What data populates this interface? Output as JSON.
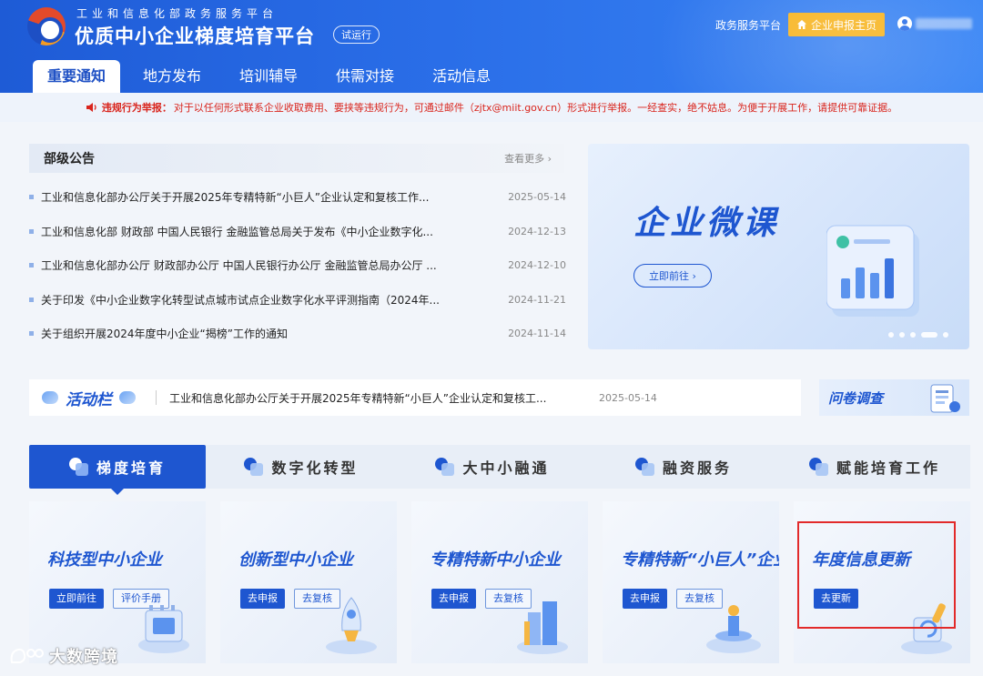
{
  "header": {
    "org_name": "工业和信息化部政务服务平台",
    "site_title": "优质中小企业梯度培育平台",
    "beta_badge": "试运行",
    "gov_link": "政务服务平台",
    "home_button": "企业申报主页"
  },
  "nav": {
    "items": [
      {
        "label": "重要通知"
      },
      {
        "label": "地方发布"
      },
      {
        "label": "培训辅导"
      },
      {
        "label": "供需对接"
      },
      {
        "label": "活动信息"
      }
    ]
  },
  "notice": {
    "label": "违规行为举报：",
    "text": "对于以任何形式联系企业收取费用、要挟等违规行为，可通过邮件（zjtx@miit.gov.cn）形式进行举报。一经查实，绝不姑息。为便于开展工作，请提供可靠证据。"
  },
  "announcements": {
    "title": "部级公告",
    "more": "查看更多 ›",
    "items": [
      {
        "text": "工业和信息化部办公厅关于开展2025年专精特新“小巨人”企业认定和复核工作...",
        "date": "2025-05-14"
      },
      {
        "text": "工业和信息化部 财政部 中国人民银行 金融监管总局关于发布《中小企业数字化...",
        "date": "2024-12-13"
      },
      {
        "text": "工业和信息化部办公厅 财政部办公厅 中国人民银行办公厅 金融监管总局办公厅 ...",
        "date": "2024-12-10"
      },
      {
        "text": "关于印发《中小企业数字化转型试点城市试点企业数字化水平评测指南（2024年...",
        "date": "2024-11-21"
      },
      {
        "text": "关于组织开展2024年度中小企业“揭榜”工作的通知",
        "date": "2024-11-14"
      }
    ]
  },
  "banner": {
    "title": "企业微课",
    "button": "立即前往 ›"
  },
  "activity": {
    "label": "活动栏",
    "text": "工业和信息化部办公厅关于开展2025年专精特新“小巨人”企业认定和复核工...",
    "date": "2025-05-14",
    "survey": "问卷调查"
  },
  "categories": [
    {
      "label": "梯度培育",
      "icon": "ladder-icon"
    },
    {
      "label": "数字化转型",
      "icon": "chart-icon"
    },
    {
      "label": "大中小融通",
      "icon": "link-icon"
    },
    {
      "label": "融资服务",
      "icon": "money-icon"
    },
    {
      "label": "赋能培育工作",
      "icon": "training-icon"
    }
  ],
  "cards": [
    {
      "title": "科技型中小企业",
      "primary": "立即前往",
      "secondary": "评价手册"
    },
    {
      "title": "创新型中小企业",
      "primary": "去申报",
      "secondary": "去复核"
    },
    {
      "title": "专精特新中小企业",
      "primary": "去申报",
      "secondary": "去复核"
    },
    {
      "title": "专精特新“小巨人”企业",
      "primary": "去申报",
      "secondary": "去复核"
    },
    {
      "title": "年度信息更新",
      "primary": "去更新"
    }
  ],
  "watermark": "大数跨境",
  "colors": {
    "brand_blue": "#1e56d0",
    "header_blue": "#2a6ee8",
    "accent_orange": "#f7b31d",
    "warning_red": "#d9241c",
    "highlight_red": "#e22a2a"
  }
}
